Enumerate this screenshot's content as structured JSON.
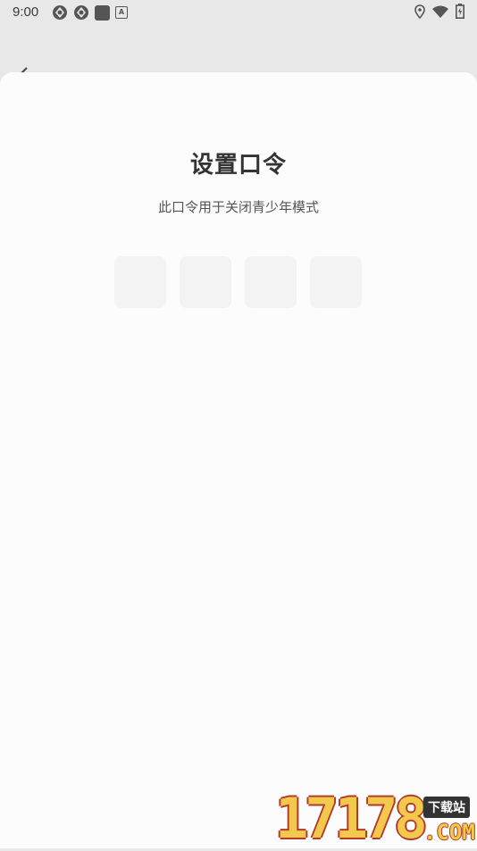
{
  "status_bar": {
    "time": "9:00",
    "left_icons": [
      "aperture-icon",
      "aperture-icon",
      "square-app-icon",
      "a-app-icon"
    ],
    "right_icons": [
      "location-icon",
      "wifi-icon",
      "battery-icon"
    ]
  },
  "header": {
    "back_icon": "chevron-left-icon"
  },
  "page": {
    "title": "设置口令",
    "subtitle": "此口令用于关闭青少年模式",
    "pin_slots": 4
  },
  "watermark": {
    "digits": "17178",
    "badge": "下载站",
    "domain": ".COM"
  },
  "colors": {
    "background": "#e8e8e8",
    "sheet": "#fcfcfc",
    "pin_box": "#f3f3f3",
    "title": "#333333"
  }
}
